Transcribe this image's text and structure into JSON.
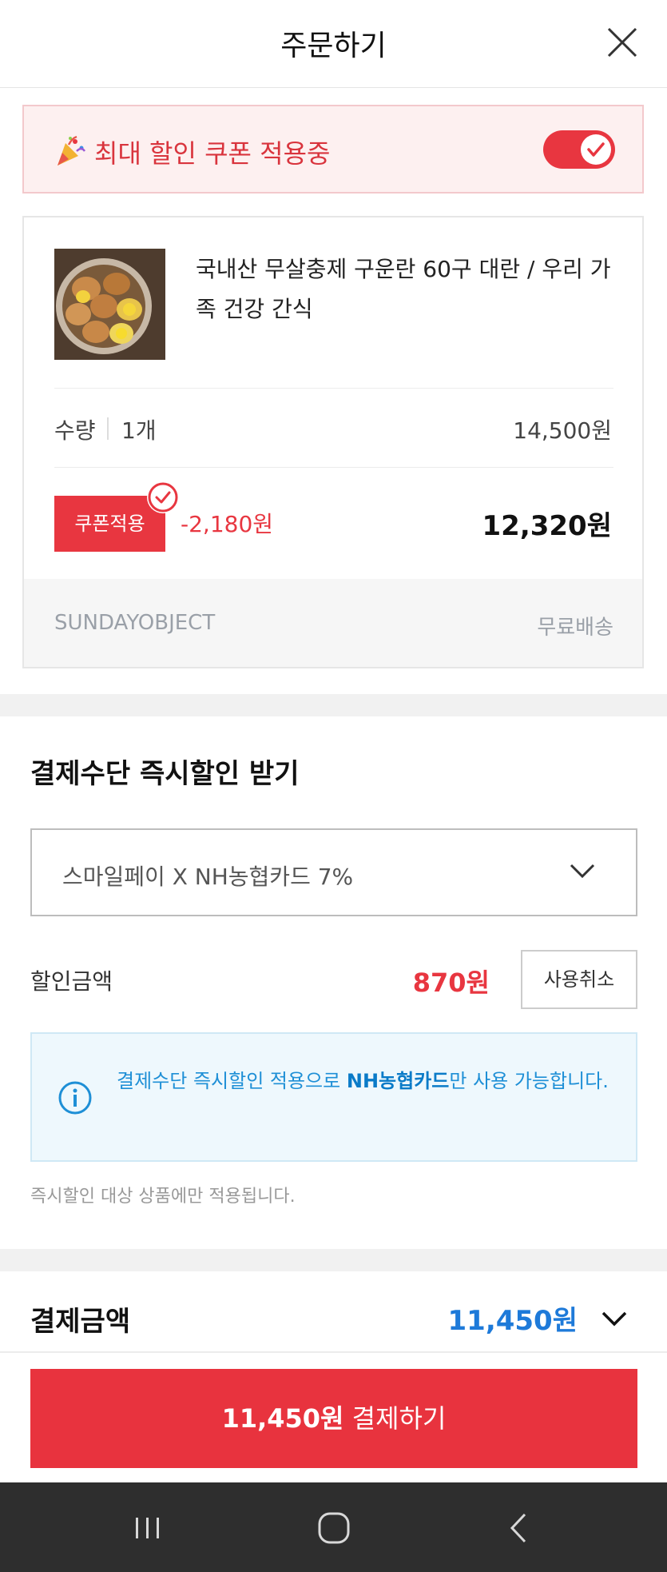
{
  "header": {
    "title": "주문하기",
    "close_icon": "close-icon"
  },
  "coupon_banner": {
    "icon": "party-popper-icon",
    "text": "최대 할인 쿠폰 적용중",
    "toggle_on": true
  },
  "product": {
    "image": "boiled-eggs-thumbnail",
    "name": "국내산 무살충제 구운란 60구 대란 / 우리 가족 건강 간식",
    "quantity_label": "수량",
    "quantity_value": "1개",
    "original_price": "14,500원",
    "coupon_badge": "쿠폰적용",
    "discount": "-2,180원",
    "final_price": "12,320원",
    "seller": "SUNDAYOBJECT",
    "shipping": "무료배송"
  },
  "payment": {
    "title": "결제수단 즉시할인 받기",
    "selected_method": "스마일페이 X NH농협카드 7%",
    "discount_label": "할인금액",
    "discount_amount": "870원",
    "cancel_label": "사용취소",
    "info_pre": "결제수단 즉시할인 적용으로 ",
    "info_bold": "NH농협카드",
    "info_post": "만 사용 가능합니다.",
    "note": "즉시할인 대상 상품에만 적용됩니다."
  },
  "total": {
    "label": "결제금액",
    "amount": "11,450원"
  },
  "pay_button": {
    "amount": "11,450원",
    "label": " 결제하기"
  },
  "colors": {
    "accent_red": "#e83640",
    "accent_blue": "#1e7ad9",
    "info_blue": "#1e8fd6"
  }
}
